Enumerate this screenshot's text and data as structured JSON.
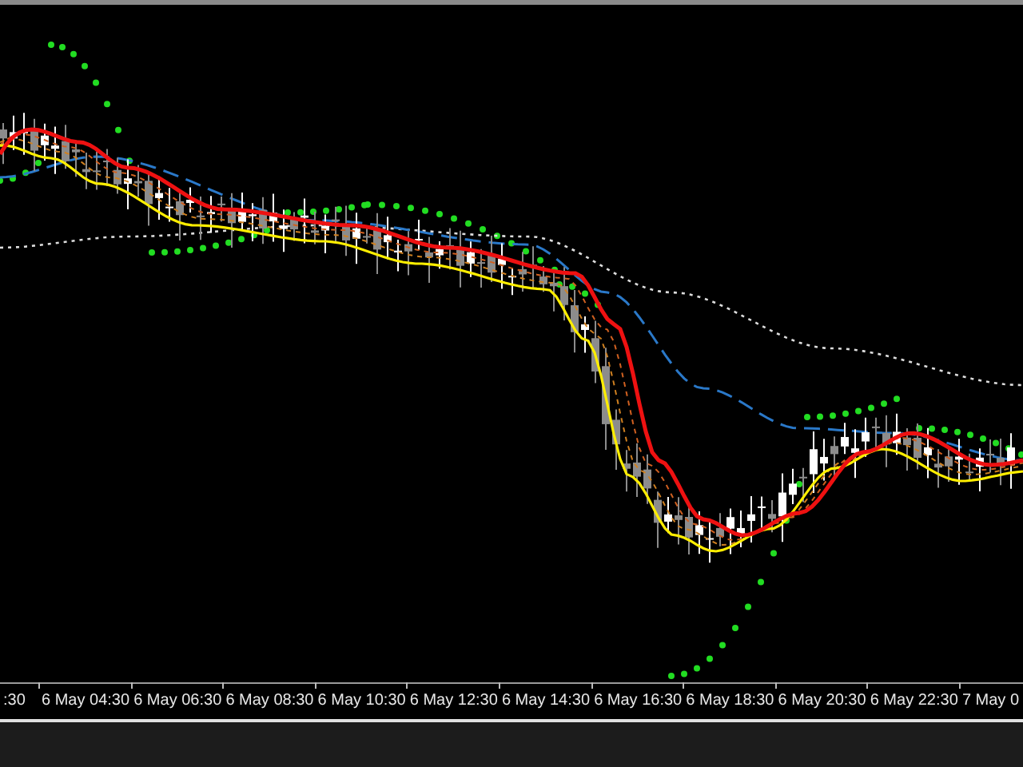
{
  "chart": {
    "x_axis_labels": [
      ":30",
      "6 May 04:30",
      "6 May 06:30",
      "6 May 08:30",
      "6 May 10:30",
      "6 May 12:30",
      "6 May 14:30",
      "6 May 16:30",
      "6 May 18:30",
      "6 May 20:30",
      "6 May 22:30",
      "7 May 0"
    ]
  }
}
